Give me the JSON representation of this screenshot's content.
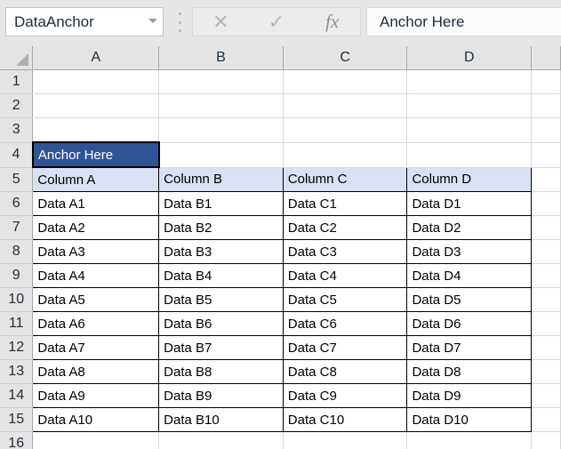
{
  "app": "spreadsheet",
  "name_box": {
    "value": "DataAnchor",
    "placeholder": "Name Box",
    "chevron_icon": "chevron-down-icon"
  },
  "formula_bar": {
    "cancel_icon": "✕",
    "enter_icon": "✓",
    "function_icon": "fx",
    "cancel_label": "Cancel",
    "enter_label": "Enter",
    "function_label": "Insert Function",
    "value": "Anchor Here",
    "placeholder": ""
  },
  "grid": {
    "select_all_icon": "select-all-triangle",
    "column_headers": [
      "A",
      "B",
      "C",
      "D"
    ],
    "row_headers": [
      "1",
      "2",
      "3",
      "4",
      "5",
      "6",
      "7",
      "8",
      "9",
      "10",
      "11",
      "12",
      "13",
      "14",
      "15",
      "16"
    ],
    "selected_cell": {
      "reference": "A4",
      "value": "Anchor Here",
      "fill": "#2F5496",
      "text_color": "#FFFFFF"
    },
    "table_header_row": {
      "row": "5",
      "fill": "#D9E1F3",
      "cells": [
        "Column A",
        "Column B",
        "Column C",
        "Column D"
      ]
    },
    "data_rows": [
      {
        "row": "6",
        "cells": [
          "Data A1",
          "Data B1",
          "Data C1",
          "Data D1"
        ]
      },
      {
        "row": "7",
        "cells": [
          "Data A2",
          "Data B2",
          "Data C2",
          "Data D2"
        ]
      },
      {
        "row": "8",
        "cells": [
          "Data A3",
          "Data B3",
          "Data C3",
          "Data D3"
        ]
      },
      {
        "row": "9",
        "cells": [
          "Data A4",
          "Data B4",
          "Data C4",
          "Data D4"
        ]
      },
      {
        "row": "10",
        "cells": [
          "Data A5",
          "Data B5",
          "Data C5",
          "Data D5"
        ]
      },
      {
        "row": "11",
        "cells": [
          "Data A6",
          "Data B6",
          "Data C6",
          "Data D6"
        ]
      },
      {
        "row": "12",
        "cells": [
          "Data A7",
          "Data B7",
          "Data C7",
          "Data D7"
        ]
      },
      {
        "row": "13",
        "cells": [
          "Data A8",
          "Data B8",
          "Data C8",
          "Data D8"
        ]
      },
      {
        "row": "14",
        "cells": [
          "Data A9",
          "Data B9",
          "Data C9",
          "Data D9"
        ]
      },
      {
        "row": "15",
        "cells": [
          "Data A10",
          "Data B10",
          "Data C10",
          "Data D10"
        ]
      }
    ],
    "empty_rows_top": [
      "1",
      "2",
      "3"
    ],
    "empty_row_bottom": "16"
  },
  "colors": {
    "header_fill": "#E4E4E4",
    "gridline": "#D6D6D6",
    "header_border": "#A6A6A6",
    "accent": "#2F5496",
    "table_header_fill": "#D9E1F3",
    "toolbar_fill": "#E6E6E6"
  }
}
